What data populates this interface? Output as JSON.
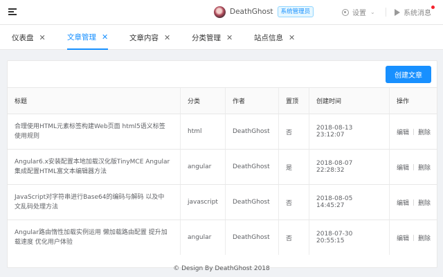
{
  "header": {
    "username": "DeathGhost",
    "role_badge": "系统管理员",
    "settings_label": "设置",
    "notify_label": "系统消息"
  },
  "tabs": [
    {
      "label": "仪表盘",
      "active": false
    },
    {
      "label": "文章管理",
      "active": true
    },
    {
      "label": "文章内容",
      "active": false
    },
    {
      "label": "分类管理",
      "active": false
    },
    {
      "label": "站点信息",
      "active": false
    }
  ],
  "toolbar": {
    "create_label": "创建文章"
  },
  "table": {
    "columns": [
      "标题",
      "分类",
      "作者",
      "置顶",
      "创建时间",
      "操作"
    ],
    "rows": [
      {
        "title": "合理使用HTML元素标签构建Web页面 html5语义标签使用规则",
        "category": "html",
        "author": "DeathGhost",
        "pinned": "否",
        "created": "2018-08-13 23:12:07",
        "edit": "编辑",
        "delete": "删除"
      },
      {
        "title": "Angular6.x安装配置本地加载汉化版TinyMCE Angular集成配置HTML富文本编辑器方法",
        "category": "angular",
        "author": "DeathGhost",
        "pinned": "是",
        "created": "2018-08-07 22:28:32",
        "edit": "编辑",
        "delete": "删除"
      },
      {
        "title": "JavaScript对字符串进行Base64的编码与解码 以及中文乱码处理方法",
        "category": "javascript",
        "author": "DeathGhost",
        "pinned": "否",
        "created": "2018-08-05 14:45:27",
        "edit": "编辑",
        "delete": "删除"
      },
      {
        "title": "Angular路由惰性加载实例运用 懒加载路由配置 提升加载速度 优化用户体验",
        "category": "angular",
        "author": "DeathGhost",
        "pinned": "否",
        "created": "2018-07-30 20:55:15",
        "edit": "编辑",
        "delete": "删除"
      }
    ]
  },
  "footer": {
    "text": "© Design By DeathGhost 2018"
  }
}
